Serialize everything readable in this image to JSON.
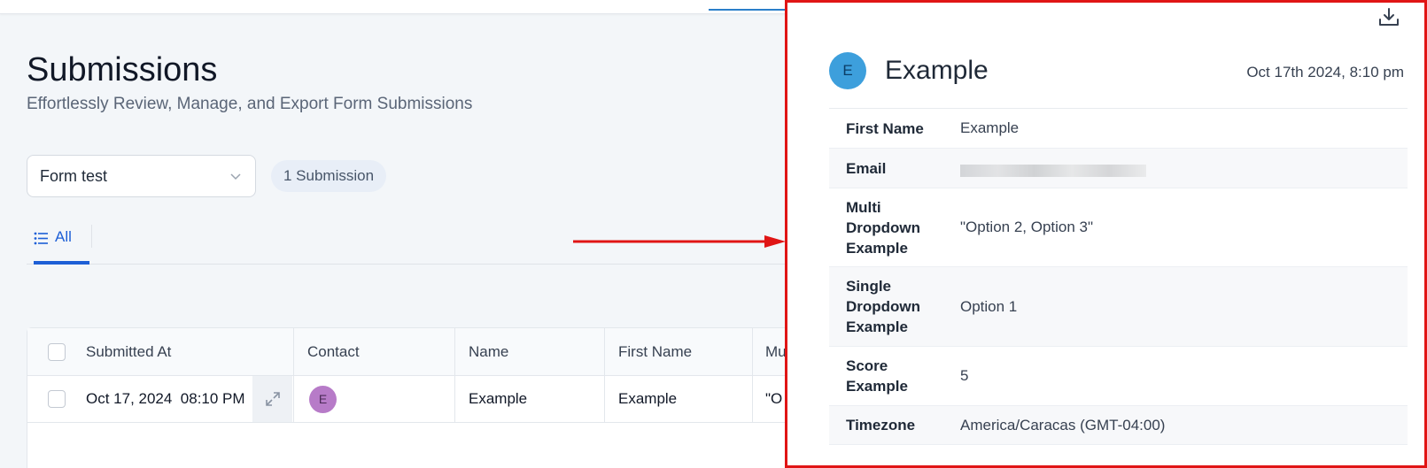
{
  "page": {
    "title": "Submissions",
    "subtitle": "Effortlessly Review, Manage, and Export Form Submissions"
  },
  "filters": {
    "form_select_value": "Form test",
    "submission_count": "1 Submission"
  },
  "tabs": [
    {
      "label": "All",
      "active": true
    }
  ],
  "table": {
    "headers": [
      "Submitted At",
      "Contact",
      "Name",
      "First Name",
      "Mu"
    ],
    "rows": [
      {
        "submitted_at": "Oct 17, 2024  08:10 PM",
        "contact_initial": "E",
        "name": "Example",
        "first_name": "Example",
        "multi": "\"O"
      }
    ]
  },
  "panel": {
    "avatar_initial": "E",
    "name": "Example",
    "date": "Oct 17th 2024, 8:10 pm",
    "fields": [
      {
        "label": "First Name",
        "value": "Example"
      },
      {
        "label": "Email",
        "value": ""
      },
      {
        "label": "Multi Dropdown Example",
        "value": "\"Option 2, Option 3\""
      },
      {
        "label": "Single Dropdown Example",
        "value": "Option 1"
      },
      {
        "label": "Score Example",
        "value": "5"
      },
      {
        "label": "Timezone",
        "value": "America/Caracas (GMT-04:00)"
      }
    ]
  },
  "colors": {
    "accent": "#1d5fd6",
    "annotation_red": "#e01515",
    "panel_avatar": "#3d9fdc",
    "contact_avatar": "#b77bc8"
  }
}
